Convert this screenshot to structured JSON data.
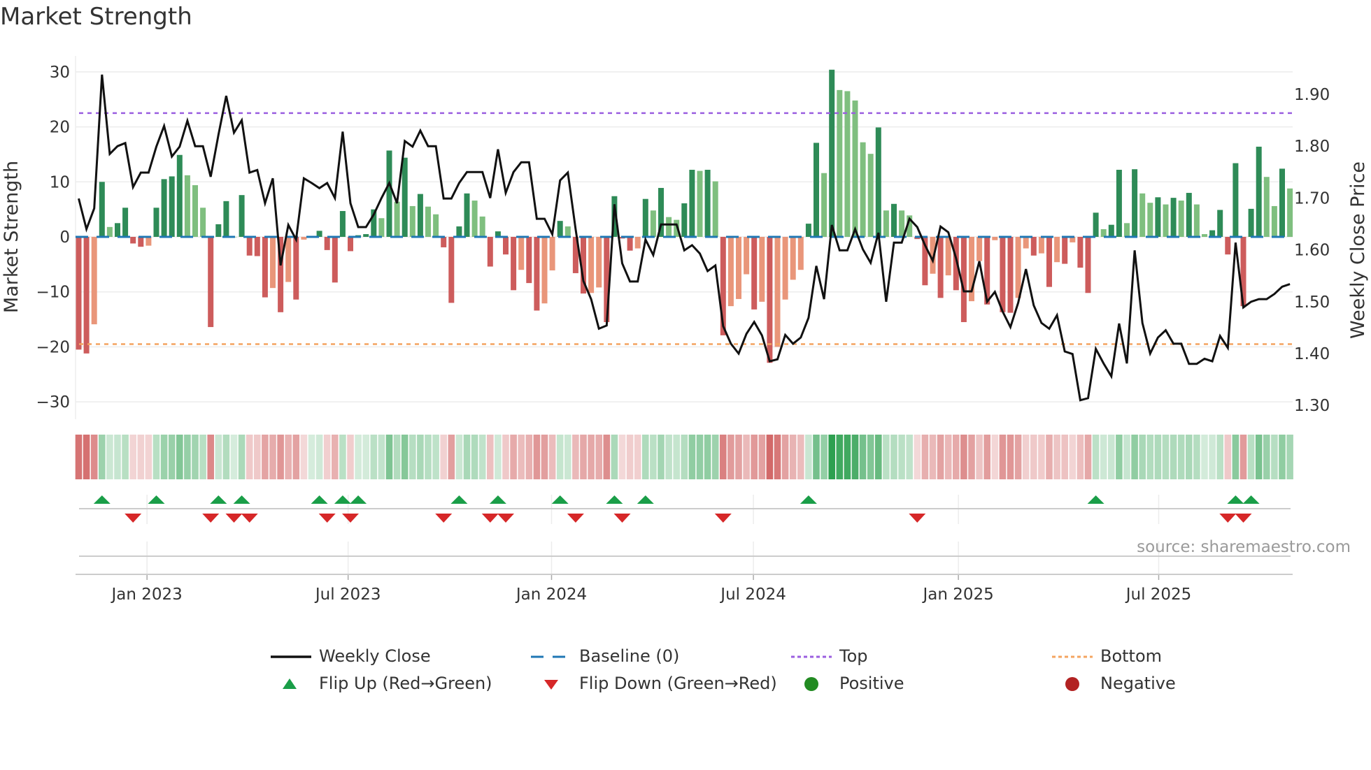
{
  "title": "Market Strength",
  "source": "source: sharemaestro.com",
  "colors": {
    "pos_strong": "#2e8b57",
    "pos_weak": "#7fbf7f",
    "neg_strong": "#cd5c5c",
    "neg_weak": "#e9967a",
    "baseline": "#1f77b4",
    "top": "#9b5fe0",
    "bottom": "#f4a460",
    "close": "#111111",
    "flip_up": "#1a9e48",
    "flip_down": "#d62728",
    "positive": "#228b22",
    "negative": "#b22222"
  },
  "chart_data": {
    "type": "bar",
    "title": "Market Strength",
    "ylabel": "Market Strength",
    "y2label": "Weekly Close Price",
    "ylim": [
      -33,
      33
    ],
    "y2lim": [
      1.2555,
      1.9445
    ],
    "yticks": [
      30,
      20,
      10,
      0,
      -10,
      -20,
      -30
    ],
    "yticklabels": [
      "30",
      "20",
      "10",
      "0",
      "−10",
      "−20",
      "−30"
    ],
    "y2ticks": [
      1.9,
      1.8,
      1.7,
      1.6,
      1.5,
      1.4,
      1.3
    ],
    "y2ticklabels": [
      "1.90",
      "1.80",
      "1.70",
      "1.60",
      "1.50",
      "1.40",
      "1.30"
    ],
    "xticks": [
      {
        "week": 8.8,
        "label": "Jan 2023"
      },
      {
        "week": 34.7,
        "label": "Jul 2023"
      },
      {
        "week": 60.9,
        "label": "Jan 2024"
      },
      {
        "week": 86.9,
        "label": "Jul 2024"
      },
      {
        "week": 113.3,
        "label": "Jan 2025"
      },
      {
        "week": 139.1,
        "label": "Jul 2025"
      }
    ],
    "top": 22.5,
    "bottom": -19.5,
    "strength": [
      -20.5,
      -21.2,
      -15.9,
      10,
      1.8,
      2.5,
      5.3,
      -1.2,
      -1.8,
      -1.6,
      5.3,
      10.5,
      11,
      14.9,
      11.2,
      9.4,
      5.3,
      -16.4,
      2.3,
      6.5,
      0,
      7.6,
      -3.4,
      -3.5,
      -11,
      -9.3,
      -13.7,
      -8.2,
      -11.4,
      -0.5,
      0,
      1.1,
      -2.4,
      -8.3,
      4.7,
      -2.6,
      0.3,
      0.5,
      5,
      3.4,
      15.7,
      6.4,
      14.4,
      5.6,
      7.8,
      5.5,
      4.1,
      -1.9,
      -12,
      1.9,
      7.9,
      6.6,
      3.7,
      -5.4,
      1,
      -3.2,
      -9.7,
      -6,
      -8.4,
      -13.4,
      -12.1,
      -6.1,
      2.9,
      1.9,
      -6.6,
      -10.3,
      -10.2,
      -9.2,
      -15.5,
      7.4,
      -0.3,
      -2.5,
      -2.1,
      6.9,
      4.8,
      8.9,
      3.6,
      3.1,
      6.1,
      12.2,
      12,
      12.2,
      10.1,
      -17.9,
      -12.6,
      -11.3,
      -6.8,
      -13.2,
      -11.8,
      -22.9,
      -20,
      -11.4,
      -7.8,
      -6,
      2.4,
      17.1,
      11.6,
      30.4,
      26.7,
      26.5,
      24.8,
      17.2,
      15.1,
      19.9,
      4.8,
      6,
      4.8,
      3.9,
      -0.4,
      -8.8,
      -6.7,
      -11.1,
      -7,
      -9.7,
      -15.5,
      -11.7,
      -4.4,
      -12.3,
      -0.6,
      -13.7,
      -13.8,
      -11.1,
      -2.1,
      -3.4,
      -3,
      -9.1,
      -4.6,
      -4.9,
      -1,
      -5.6,
      -10.2,
      4.4,
      1.4,
      2.2,
      12.2,
      2.5,
      12.3,
      7.9,
      6.2,
      7.2,
      5.9,
      7.1,
      6.6,
      8,
      5.9,
      0.5,
      1.2,
      4.9,
      -3.2,
      13.4,
      -12.6,
      5.1,
      16.4,
      10.9,
      5.6,
      12.4,
      8.8
    ],
    "close": [
      1.699,
      1.64,
      1.68,
      1.938,
      1.785,
      1.8,
      1.806,
      1.721,
      1.749,
      1.749,
      1.799,
      1.839,
      1.78,
      1.799,
      1.849,
      1.8,
      1.8,
      1.741,
      1.822,
      1.897,
      1.826,
      1.85,
      1.749,
      1.754,
      1.69,
      1.738,
      1.57,
      1.648,
      1.62,
      1.738,
      1.729,
      1.719,
      1.729,
      1.7,
      1.828,
      1.69,
      1.644,
      1.644,
      1.668,
      1.7,
      1.729,
      1.69,
      1.81,
      1.799,
      1.83,
      1.8,
      1.8,
      1.699,
      1.699,
      1.729,
      1.75,
      1.75,
      1.75,
      1.7,
      1.794,
      1.71,
      1.75,
      1.769,
      1.769,
      1.66,
      1.66,
      1.63,
      1.734,
      1.749,
      1.64,
      1.54,
      1.505,
      1.448,
      1.454,
      1.688,
      1.574,
      1.539,
      1.539,
      1.62,
      1.59,
      1.649,
      1.649,
      1.649,
      1.599,
      1.609,
      1.593,
      1.559,
      1.57,
      1.453,
      1.419,
      1.4,
      1.438,
      1.461,
      1.435,
      1.385,
      1.389,
      1.436,
      1.419,
      1.431,
      1.469,
      1.569,
      1.505,
      1.648,
      1.599,
      1.599,
      1.64,
      1.601,
      1.575,
      1.633,
      1.5,
      1.614,
      1.614,
      1.66,
      1.644,
      1.609,
      1.579,
      1.645,
      1.634,
      1.584,
      1.52,
      1.52,
      1.578,
      1.5,
      1.519,
      1.481,
      1.451,
      1.498,
      1.563,
      1.493,
      1.459,
      1.448,
      1.474,
      1.404,
      1.399,
      1.31,
      1.314,
      1.409,
      1.381,
      1.356,
      1.458,
      1.381,
      1.599,
      1.459,
      1.4,
      1.431,
      1.445,
      1.419,
      1.419,
      1.38,
      1.38,
      1.39,
      1.385,
      1.434,
      1.411,
      1.614,
      1.489,
      1.5,
      1.505,
      1.505,
      1.515,
      1.529,
      1.534
    ],
    "flip_up_weeks": [
      3,
      10,
      18,
      21,
      31,
      34,
      36,
      49,
      54,
      62,
      69,
      73,
      94,
      131,
      149,
      151
    ],
    "flip_down_weeks": [
      7,
      17,
      20,
      22,
      32,
      35,
      47,
      53,
      55,
      64,
      70,
      83,
      108,
      148,
      150
    ],
    "legend": [
      {
        "key": "close",
        "label": "Weekly Close"
      },
      {
        "key": "baseline",
        "label": "Baseline (0)"
      },
      {
        "key": "top",
        "label": "Top"
      },
      {
        "key": "bottom",
        "label": "Bottom"
      },
      {
        "key": "flip_up",
        "label": "Flip Up (Red→Green)"
      },
      {
        "key": "flip_down",
        "label": "Flip Down (Green→Red)"
      },
      {
        "key": "positive",
        "label": "Positive"
      },
      {
        "key": "negative",
        "label": "Negative"
      }
    ],
    "legend_position": "bottom"
  }
}
